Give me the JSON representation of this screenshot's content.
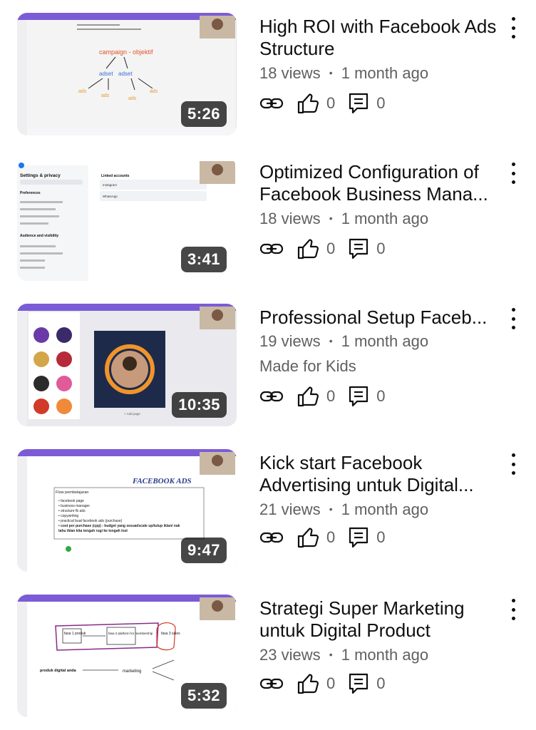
{
  "videos": [
    {
      "title": "High ROI with Facebook Ads Structure",
      "views": "18 views",
      "age": "1 month ago",
      "duration": "5:26",
      "likes": "0",
      "comments": "0",
      "kids": "",
      "slide": {
        "lines": [
          "campaign - objektif",
          "adset",
          "adset",
          "ads",
          "ads",
          "ads",
          "ads"
        ]
      }
    },
    {
      "title": "Optimized Configuration of Facebook Business Mana...",
      "views": "18 views",
      "age": "1 month ago",
      "duration": "3:41",
      "likes": "0",
      "comments": "0",
      "kids": "",
      "slide": {
        "lines": [
          "Settings & privacy",
          "Preferences",
          "Audience and visibility",
          "Linked accounts",
          "Instagram",
          "WhatsApp"
        ]
      }
    },
    {
      "title": "Professional Setup Faceb...",
      "views": "19 views",
      "age": "1 month ago",
      "duration": "10:35",
      "likes": "0",
      "comments": "0",
      "kids": "Made for Kids",
      "slide": {
        "lines": [
          "+ Add page"
        ]
      }
    },
    {
      "title": "Kick start Facebook Advertising untuk Digital...",
      "views": "21 views",
      "age": "1 month ago",
      "duration": "9:47",
      "likes": "0",
      "comments": "0",
      "kids": "",
      "slide": {
        "lines": [
          "FACEBOOK ADS",
          "Flow pembelajaran",
          "• facebook page",
          "• business manager",
          "• structure fb ads",
          "• copywriting",
          "• practical buat facebook ads (purchase)",
          "• cost per purchase (cpp) - budget yang sesuai/scale up/tutup iklan/ nak",
          "  tahu iklan kita tengah rugi ke tengah lost"
        ]
      }
    },
    {
      "title": "Strategi Super Marketing untuk Digital Product",
      "views": "23 views",
      "age": "1 month ago",
      "duration": "5:32",
      "likes": "0",
      "comments": "0",
      "kids": "",
      "slide": {
        "lines": [
          "fasa 1 produk",
          "fasa 2 platform for membership",
          "fasa 3 sales",
          "produk digital anda",
          "marketing"
        ]
      }
    }
  ],
  "separator": "•",
  "colors": {
    "text": "#0f0f0f",
    "meta": "#606060",
    "badge": "#000000"
  },
  "icons": {
    "share": "link-icon",
    "like": "thumbs-up-icon",
    "comment": "comment-icon",
    "menu": "more-vert-icon"
  }
}
